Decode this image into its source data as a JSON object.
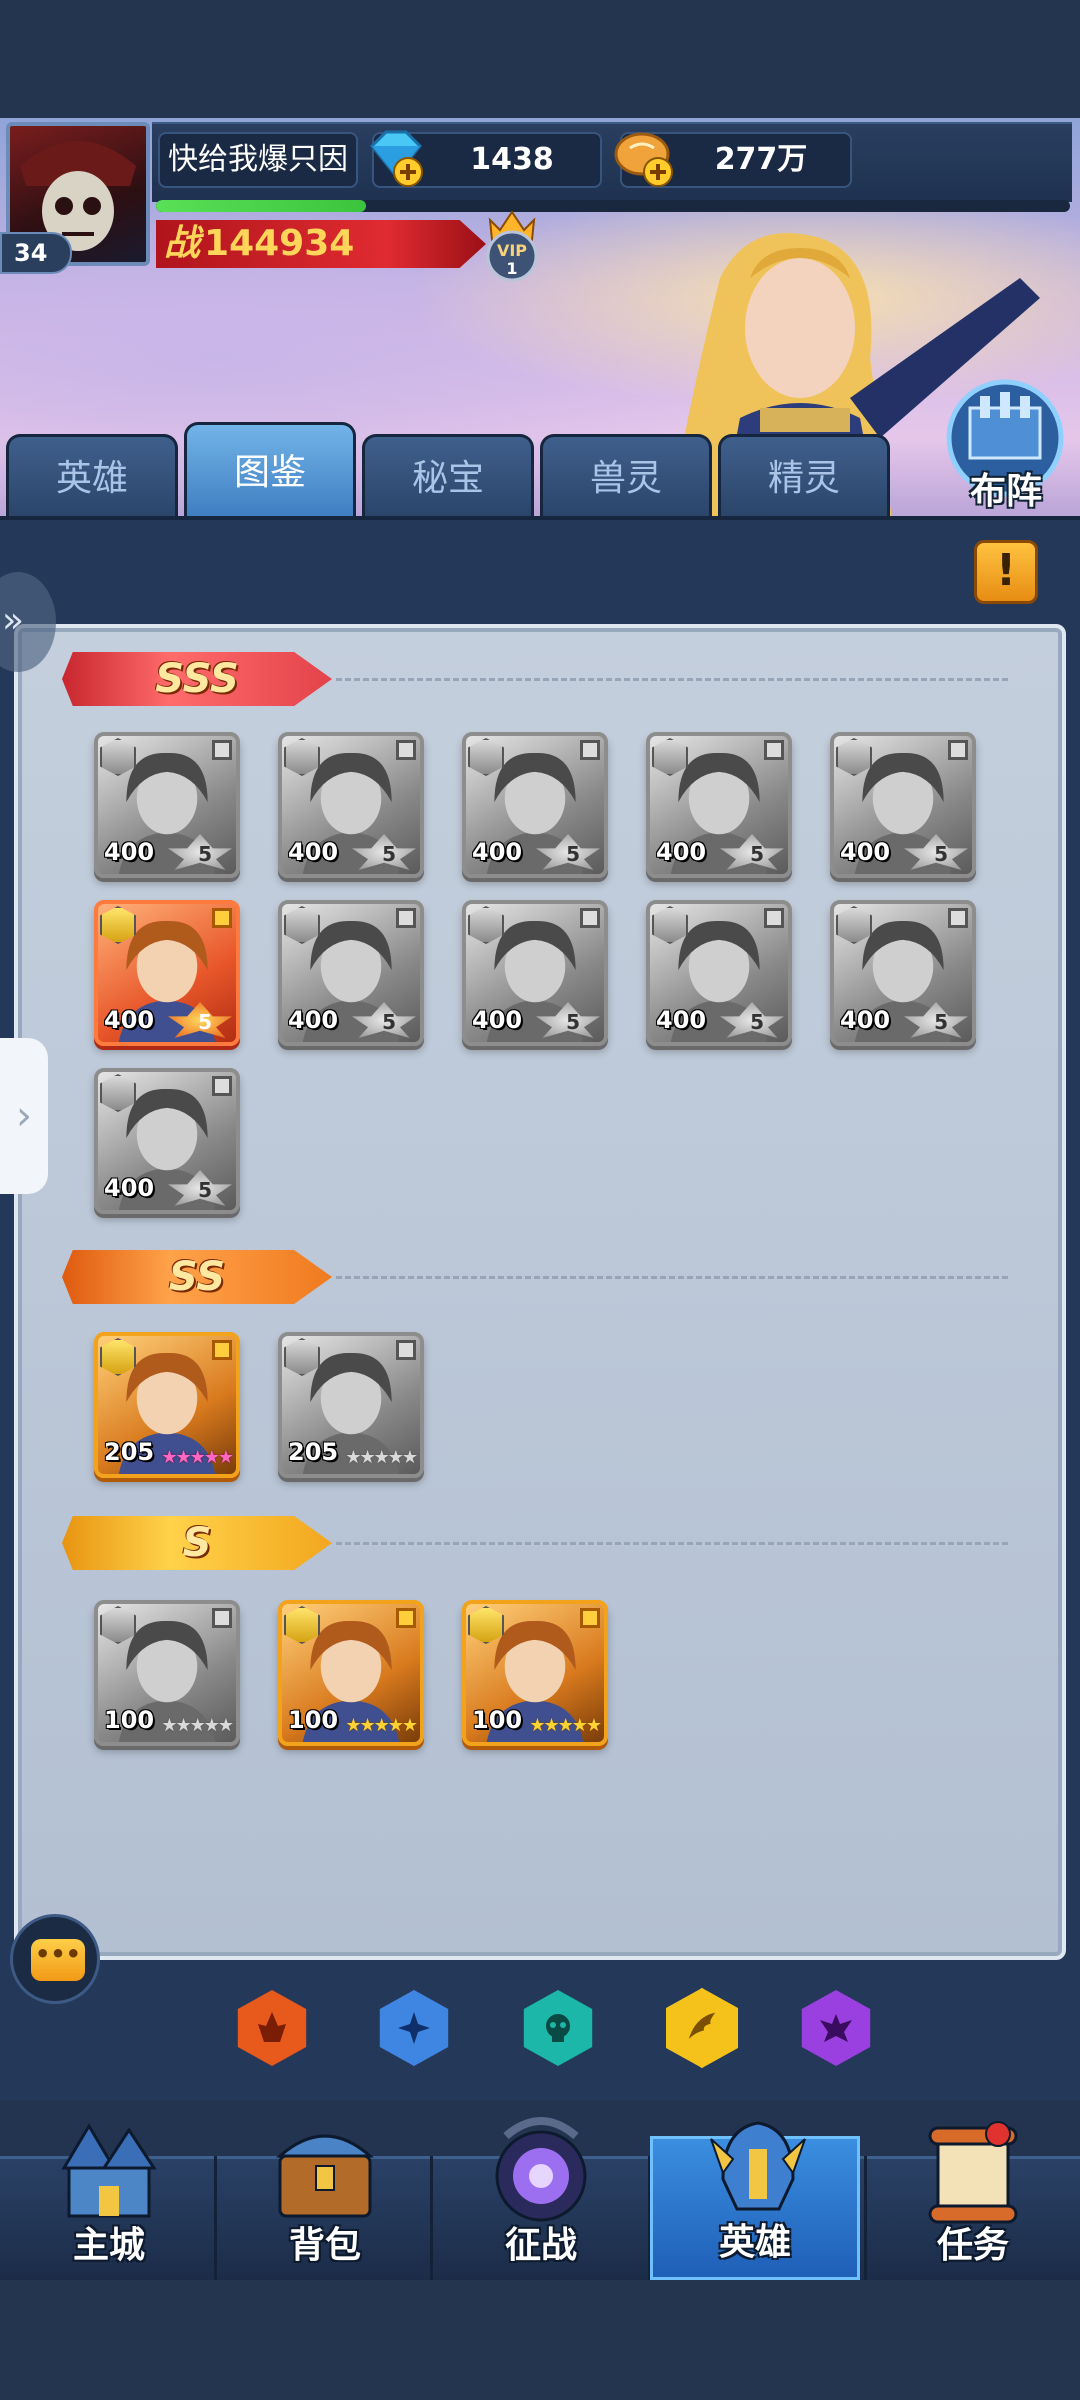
{
  "player": {
    "name": "快给我爆只因",
    "level": "34",
    "gems": "1438",
    "gold": "277万",
    "power_prefix": "战",
    "power": "144934",
    "vip_label": "VIP",
    "vip_level": "1",
    "exp_progress": 0.23
  },
  "lineup_label": "布阵",
  "tabs": [
    {
      "label": "英雄",
      "active": false
    },
    {
      "label": "图鉴",
      "active": true
    },
    {
      "label": "秘宝",
      "active": false
    },
    {
      "label": "兽灵",
      "active": false
    },
    {
      "label": "精灵",
      "active": false
    }
  ],
  "warning_label": "!",
  "ranks": {
    "sss": {
      "label": "SSS",
      "heroes": [
        {
          "level": "400",
          "star": "5",
          "owned": false
        },
        {
          "level": "400",
          "star": "5",
          "owned": false
        },
        {
          "level": "400",
          "star": "5",
          "owned": false
        },
        {
          "level": "400",
          "star": "5",
          "owned": false
        },
        {
          "level": "400",
          "star": "5",
          "owned": false
        },
        {
          "level": "400",
          "star": "5",
          "owned": true
        },
        {
          "level": "400",
          "star": "5",
          "owned": false
        },
        {
          "level": "400",
          "star": "5",
          "owned": false
        },
        {
          "level": "400",
          "star": "5",
          "owned": false
        },
        {
          "level": "400",
          "star": "5",
          "owned": false
        },
        {
          "level": "400",
          "star": "5",
          "owned": false
        }
      ]
    },
    "ss": {
      "label": "SS",
      "heroes": [
        {
          "level": "205",
          "stars": "★★★★★",
          "owned": true
        },
        {
          "level": "205",
          "stars": "★★★★★",
          "owned": false
        }
      ]
    },
    "s": {
      "label": "S",
      "heroes": [
        {
          "level": "100",
          "stars": "★★★★★",
          "owned": false
        },
        {
          "level": "100",
          "stars": "★★★★★",
          "owned": true
        },
        {
          "level": "100",
          "stars": "★★★★★",
          "owned": true
        }
      ]
    }
  },
  "chat_icon": "chat-icon",
  "factions": [
    {
      "name": "fire-faction-icon",
      "color": "#e8591c"
    },
    {
      "name": "water-faction-icon",
      "color": "#3f86e3"
    },
    {
      "name": "skull-faction-icon",
      "color": "#1cb7a8"
    },
    {
      "name": "wing-faction-icon",
      "color": "#f5c21b",
      "selected": true
    },
    {
      "name": "dark-faction-icon",
      "color": "#9a3fe0"
    }
  ],
  "nav": [
    {
      "label": "主城",
      "active": false
    },
    {
      "label": "背包",
      "active": false
    },
    {
      "label": "征战",
      "active": false
    },
    {
      "label": "英雄",
      "active": true
    },
    {
      "label": "任务",
      "active": false
    }
  ]
}
